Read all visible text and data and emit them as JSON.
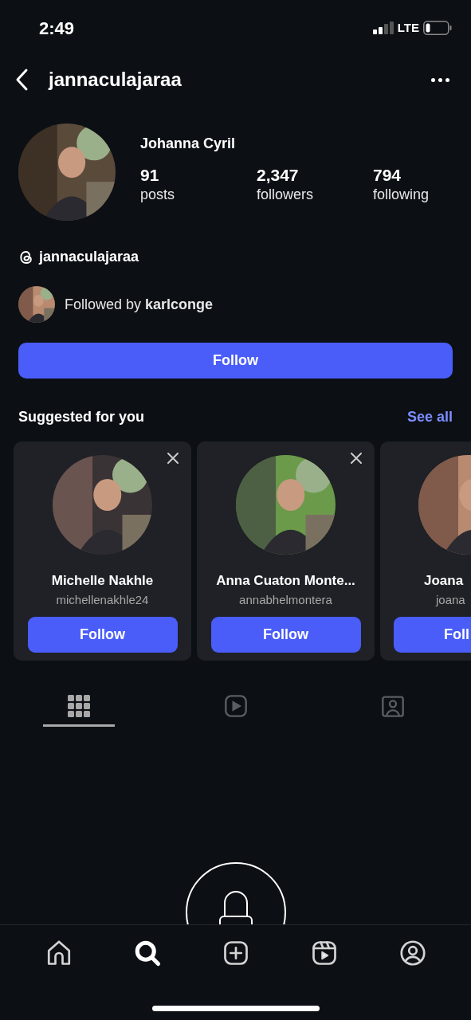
{
  "status_bar": {
    "time": "2:49",
    "network": "LTE"
  },
  "header": {
    "title": "jannaculajaraa"
  },
  "profile": {
    "name": "Johanna Cyril",
    "stats": [
      {
        "value": "91",
        "label": "posts"
      },
      {
        "value": "2,347",
        "label": "followers"
      },
      {
        "value": "794",
        "label": "following"
      }
    ],
    "threads_handle": "jannaculajaraa",
    "followed_by": "Followed by **karlconge**"
  },
  "follow_button": "Follow",
  "suggested": {
    "title": "Suggested for you",
    "see_all": "See all",
    "cards": [
      {
        "kind": "full",
        "name": "Michelle Nakhle",
        "handle": "michellenakhle24",
        "button": "Follow"
      },
      {
        "kind": "full",
        "name": "Anna Cuaton Monte...",
        "handle": "annabhelmontera",
        "button": "Follow"
      },
      {
        "kind": "partial",
        "name": "Joana",
        "handle": "joana",
        "button": "Foll"
      }
    ]
  },
  "profile_tabs": [
    {
      "kind": "grid",
      "selected": true
    },
    {
      "kind": "reels",
      "selected": false
    },
    {
      "kind": "tagged",
      "selected": false
    }
  ],
  "bottom_nav": [
    {
      "kind": "home",
      "selected": false
    },
    {
      "kind": "search",
      "selected": true
    },
    {
      "kind": "create",
      "selected": false
    },
    {
      "kind": "reels",
      "selected": false
    },
    {
      "kind": "profile",
      "selected": false
    }
  ]
}
